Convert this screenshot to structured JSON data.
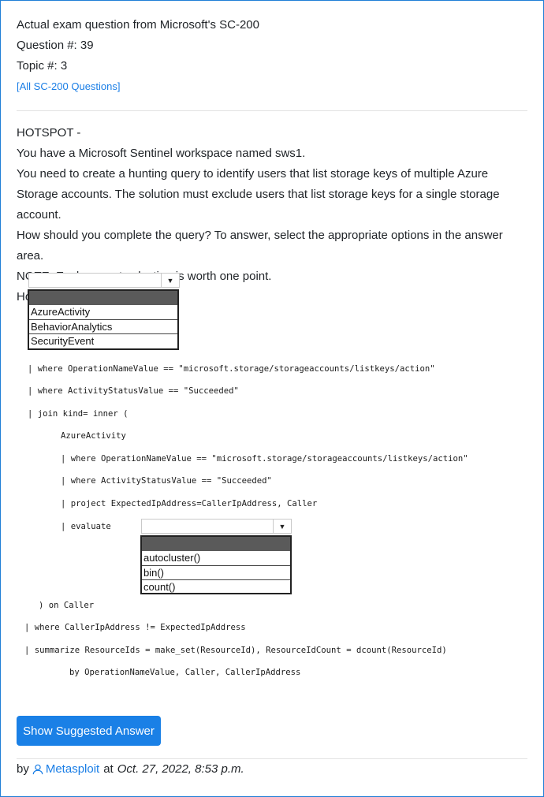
{
  "header": {
    "line1": "Actual exam question from Microsoft's SC-200",
    "question_no": "Question #: 39",
    "topic_no": "Topic #: 3",
    "all_questions_link": "[All SC-200 Questions]"
  },
  "question": {
    "type": "HOTSPOT -",
    "line1": "You have a Microsoft Sentinel workspace named sws1.",
    "line2": "You need to create a hunting query to identify users that list storage keys of multiple Azure Storage accounts. The solution must exclude users that list storage keys for a single storage account.",
    "line3": "How should you complete the query? To answer, select the appropriate options in the answer area.",
    "line4": "NOTE: Each correct selection is worth one point.",
    "line5": "Hot Area:"
  },
  "hot_area": {
    "dropdown1": {
      "selected": "",
      "options": [
        "AzureActivity",
        "BehaviorAnalytics",
        "SecurityEvent"
      ]
    },
    "dropdown2": {
      "selected": "",
      "options": [
        "autocluster()",
        "bin()",
        "count()"
      ]
    },
    "code": [
      "| where OperationNameValue == \"microsoft.storage/storageaccounts/listkeys/action\"",
      "| where ActivityStatusValue == \"Succeeded\"",
      "| join kind= inner (",
      "AzureActivity",
      "| where OperationNameValue == \"microsoft.storage/storageaccounts/listkeys/action\"",
      "| where ActivityStatusValue == \"Succeeded\"",
      "| project ExpectedIpAddress=CallerIpAddress, Caller",
      "| evaluate",
      ") on Caller",
      "| where CallerIpAddress != ExpectedIpAddress",
      "| summarize ResourceIds = make_set(ResourceId), ResourceIdCount = dcount(ResourceId)",
      "by OperationNameValue, Caller, CallerIpAddress"
    ]
  },
  "actions": {
    "show_answer_label": "Show Suggested Answer"
  },
  "footer": {
    "by": "by",
    "username": "Metasploit",
    "at": "at",
    "date": "Oct. 27, 2022, 8:53 p.m.",
    "user_icon": "user-icon"
  },
  "colors": {
    "accent": "#1a80e6",
    "border": "#1f7fd6"
  }
}
